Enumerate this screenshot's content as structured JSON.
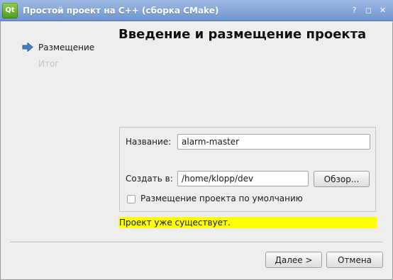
{
  "window": {
    "icon_text": "Qt",
    "title": "Простой проект на С++ (сборка CMake)",
    "wm_buttons": {
      "help": "?",
      "maximize": "◻",
      "close": "✕"
    }
  },
  "wizard": {
    "steps": [
      {
        "label": "Размещение",
        "current": true
      },
      {
        "label": "Итог",
        "current": false
      }
    ],
    "page_title": "Введение и размещение проекта"
  },
  "form": {
    "name_label": "Название:",
    "name_value": "alarm-master",
    "create_in_label": "Создать в:",
    "path_value": "/home/klopp/dev",
    "browse_label": "Обзор...",
    "default_location_label": "Размещение проекта по умолчанию",
    "default_location_checked": false
  },
  "status": {
    "message": "Проект уже существует.",
    "background": "#ffff00"
  },
  "buttons": {
    "next": "Далее >",
    "cancel": "Отмена"
  },
  "colors": {
    "titlebar": "#7b9fd6",
    "step_arrow": "#4a7fc8",
    "inactive_step": "#c4c4c2"
  }
}
